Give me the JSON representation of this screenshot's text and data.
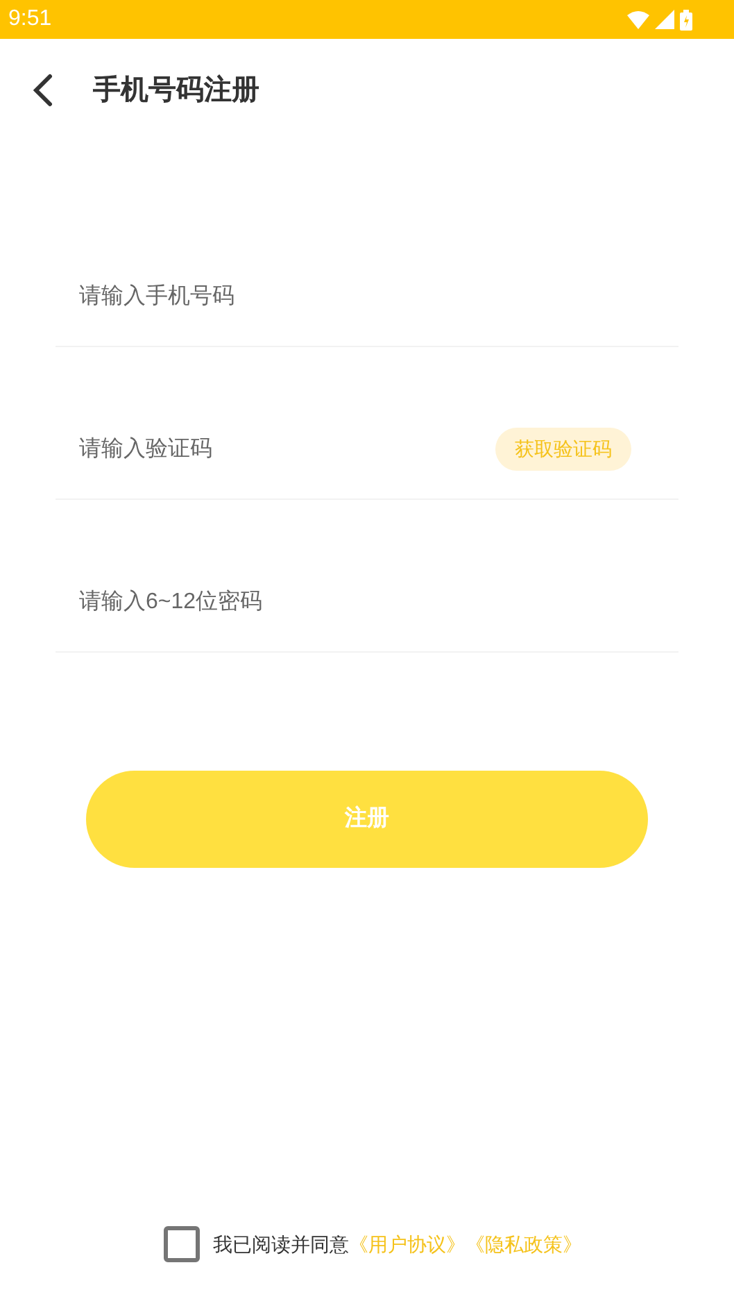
{
  "status_bar": {
    "time": "9:51"
  },
  "header": {
    "title": "手机号码注册"
  },
  "fields": [
    {
      "placeholder": "请输入手机号码"
    },
    {
      "placeholder": "请输入验证码",
      "action": "获取验证码"
    },
    {
      "placeholder": "请输入6~12位密码"
    }
  ],
  "submit": {
    "label": "注册"
  },
  "agreement": {
    "checked": false,
    "text": "我已阅读并同意",
    "links": [
      "《用户协议》",
      "《隐私政策》"
    ]
  }
}
